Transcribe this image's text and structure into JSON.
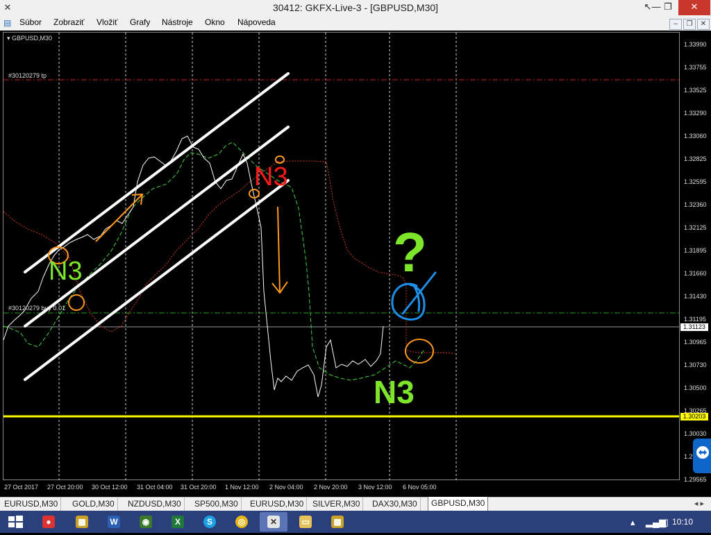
{
  "window": {
    "title": "30412: GKFX-Live-3 - [GBPUSD,M30]",
    "minimize": "—",
    "restore": "❐",
    "close": "✕"
  },
  "menu": [
    "Súbor",
    "Zobraziť",
    "Vložiť",
    "Grafy",
    "Nástroje",
    "Okno",
    "Nápoveda"
  ],
  "chart": {
    "symbol": "GBPUSD,M30",
    "tp_label": "#30120279 tp",
    "buy_label": "#30120279 buy 0.01",
    "price_axis": [
      "1.33990",
      "1.33755",
      "1.33525",
      "1.33290",
      "1.33060",
      "1.32825",
      "1.32595",
      "1.32360",
      "1.32125",
      "1.31895",
      "1.31660",
      "1.31430",
      "1.31195",
      "1.30965",
      "1.30730",
      "1.30500",
      "1.30265",
      "1.30030",
      "1.29...",
      "1.29565"
    ],
    "current_price": "1.31123",
    "yellow_price": "1.30203",
    "time_axis": [
      "27 Oct 2017",
      "27 Oct 20:00",
      "30 Oct 12:00",
      "31 Oct 04:00",
      "31 Oct 20:00",
      "1 Nov 12:00",
      "2 Nov 04:00",
      "2 Nov 20:00",
      "3 Nov 12:00",
      "6 Nov 05:00"
    ],
    "annotations": {
      "n3_left": "N3",
      "n3_top": "N3",
      "n3_bottom": "N3",
      "question": "?"
    },
    "colors": {
      "green_text": "#7ee62a",
      "red_text": "#ff1a1a",
      "yellow_line": "#ffff00",
      "orange": "#ff9a1e",
      "blue": "#1e8fe8"
    }
  },
  "tabs": [
    "EURUSD,M30",
    "GOLD,M30",
    "NZDUSD,M30",
    "SP500,M30",
    "EURUSD,M30",
    "SILVER,M30",
    "DAX30,M30",
    "GBPUSD,M30"
  ],
  "active_tab": "GBPUSD,M30",
  "taskbar": {
    "clock": "10:10"
  }
}
